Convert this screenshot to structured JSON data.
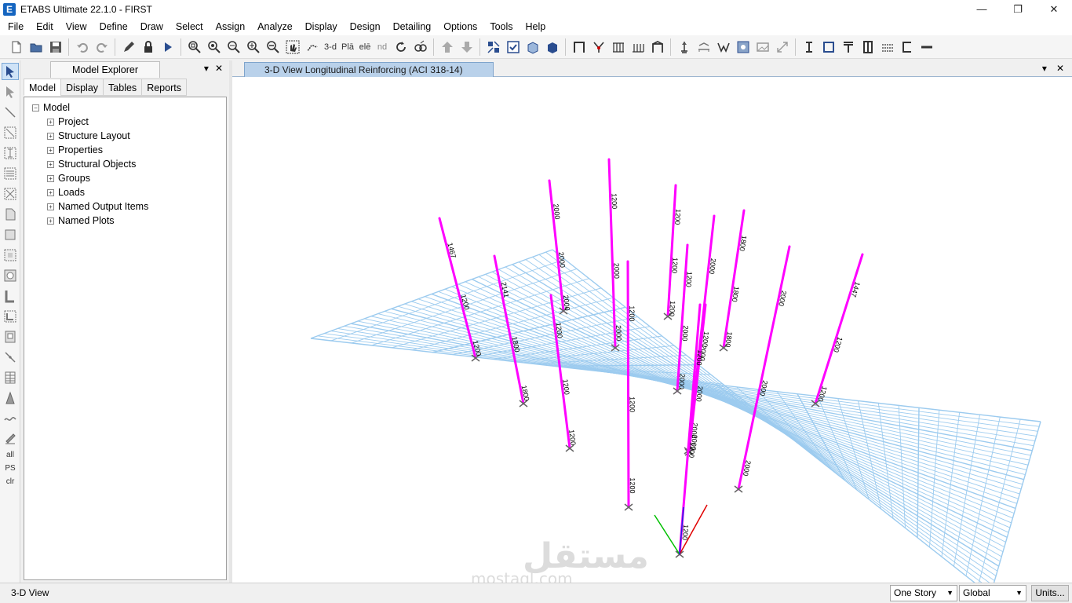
{
  "window": {
    "title": "ETABS Ultimate 22.1.0 - FIRST",
    "icon_letter": "E",
    "minimize": "—",
    "maximize": "❐",
    "close": "✕"
  },
  "menu": [
    "File",
    "Edit",
    "View",
    "Define",
    "Draw",
    "Select",
    "Assign",
    "Analyze",
    "Display",
    "Design",
    "Detailing",
    "Options",
    "Tools",
    "Help"
  ],
  "toolbar": {
    "view_3d": "3-d",
    "plan": "Plā",
    "elev": "elē",
    "nd": "nd"
  },
  "left_toolbar": {
    "all": "all",
    "ps": "PS",
    "clr": "clr"
  },
  "explorer": {
    "title": "Model Explorer",
    "tabs": [
      "Model",
      "Display",
      "Tables",
      "Reports"
    ],
    "root": "Model",
    "items": [
      "Project",
      "Structure Layout",
      "Properties",
      "Structural Objects",
      "Groups",
      "Loads",
      "Named Output Items",
      "Named Plots"
    ]
  },
  "view": {
    "tab_title": "3-D View  Longitudinal Reinforcing  (ACI 318-14)",
    "colors": {
      "column": "#ff00ff",
      "grid": "#9ccbef",
      "axis_x": "#e00000",
      "axis_y": "#00c000",
      "axis_z": "#2020e0"
    },
    "column_labels": [
      [
        "1467",
        "1200",
        "1200"
      ],
      [
        "2141",
        "1800",
        "1800"
      ],
      [
        "2000",
        "2000",
        "2000"
      ],
      [
        "1200",
        "1200",
        "1200"
      ],
      [
        "1200",
        "2000",
        "2000"
      ],
      [
        "1200",
        "1200",
        "1200"
      ],
      [
        "1200",
        "1200",
        "1200"
      ],
      [
        "1200",
        "2000",
        "2000"
      ],
      [
        "2000",
        "2000",
        "2000"
      ],
      [
        "1800",
        "1800",
        "1800"
      ],
      [
        "2000",
        "2000",
        "2000"
      ],
      [
        "1447",
        "1200",
        "1200"
      ],
      [
        "1200",
        "2000",
        "2000"
      ],
      [
        "1200",
        "1200",
        "1200"
      ]
    ],
    "watermark": {
      "arabic": "مستقل",
      "latin": "mostaql.com"
    }
  },
  "status": {
    "view_name": "3-D View",
    "story_select": "One Story",
    "coord_select": "Global",
    "units_button": "Units..."
  }
}
